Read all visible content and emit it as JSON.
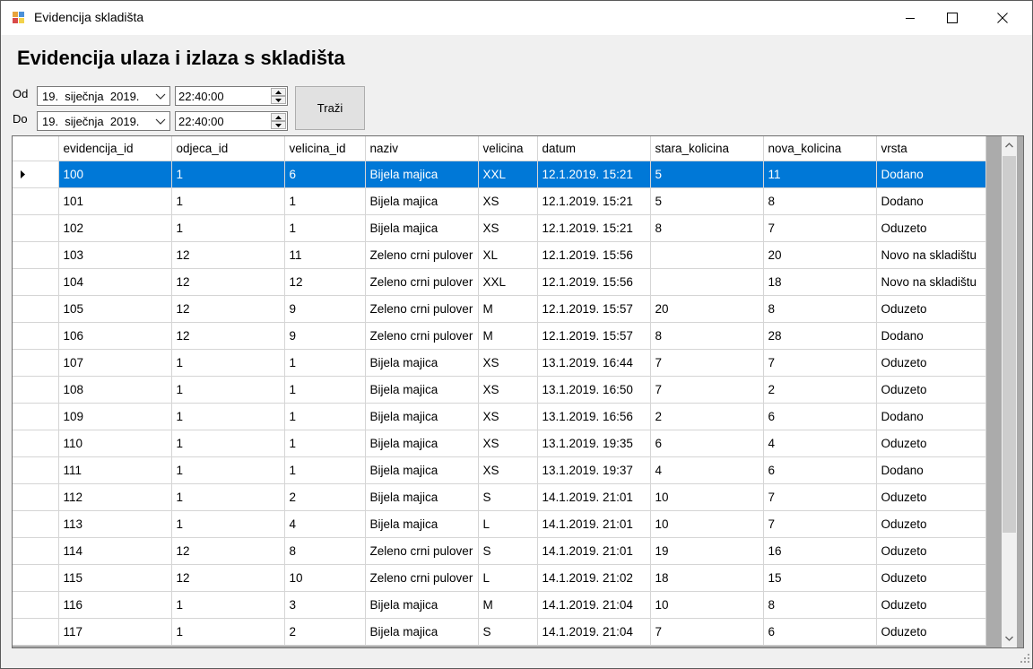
{
  "window": {
    "title": "Evidencija skladišta"
  },
  "heading": "Evidencija ulaza i izlaza s skladišta",
  "filters": {
    "from_label": "Od",
    "to_label": "Do",
    "from_date": "19.  siječnja  2019.",
    "to_date": "19.  siječnja  2019.",
    "from_time": "22:40:00",
    "to_time": "22:40:00"
  },
  "search_button": "Traži",
  "table": {
    "columns": [
      "evidencija_id",
      "odjeca_id",
      "velicina_id",
      "naziv",
      "velicina",
      "datum",
      "stara_kolicina",
      "nova_kolicina",
      "vrsta"
    ],
    "selected_row": 0,
    "rows": [
      [
        "100",
        "1",
        "6",
        "Bijela majica",
        "XXL",
        "12.1.2019. 15:21",
        "5",
        "11",
        "Dodano"
      ],
      [
        "101",
        "1",
        "1",
        "Bijela majica",
        "XS",
        "12.1.2019. 15:21",
        "5",
        "8",
        "Dodano"
      ],
      [
        "102",
        "1",
        "1",
        "Bijela majica",
        "XS",
        "12.1.2019. 15:21",
        "8",
        "7",
        "Oduzeto"
      ],
      [
        "103",
        "12",
        "11",
        "Zeleno crni pulover",
        "XL",
        "12.1.2019. 15:56",
        "",
        "20",
        "Novo na skladištu"
      ],
      [
        "104",
        "12",
        "12",
        "Zeleno crni pulover",
        "XXL",
        "12.1.2019. 15:56",
        "",
        "18",
        "Novo na skladištu"
      ],
      [
        "105",
        "12",
        "9",
        "Zeleno crni pulover",
        "M",
        "12.1.2019. 15:57",
        "20",
        "8",
        "Oduzeto"
      ],
      [
        "106",
        "12",
        "9",
        "Zeleno crni pulover",
        "M",
        "12.1.2019. 15:57",
        "8",
        "28",
        "Dodano"
      ],
      [
        "107",
        "1",
        "1",
        "Bijela majica",
        "XS",
        "13.1.2019. 16:44",
        "7",
        "7",
        "Oduzeto"
      ],
      [
        "108",
        "1",
        "1",
        "Bijela majica",
        "XS",
        "13.1.2019. 16:50",
        "7",
        "2",
        "Oduzeto"
      ],
      [
        "109",
        "1",
        "1",
        "Bijela majica",
        "XS",
        "13.1.2019. 16:56",
        "2",
        "6",
        "Dodano"
      ],
      [
        "110",
        "1",
        "1",
        "Bijela majica",
        "XS",
        "13.1.2019. 19:35",
        "6",
        "4",
        "Oduzeto"
      ],
      [
        "111",
        "1",
        "1",
        "Bijela majica",
        "XS",
        "13.1.2019. 19:37",
        "4",
        "6",
        "Dodano"
      ],
      [
        "112",
        "1",
        "2",
        "Bijela majica",
        "S",
        "14.1.2019. 21:01",
        "10",
        "7",
        "Oduzeto"
      ],
      [
        "113",
        "1",
        "4",
        "Bijela majica",
        "L",
        "14.1.2019. 21:01",
        "10",
        "7",
        "Oduzeto"
      ],
      [
        "114",
        "12",
        "8",
        "Zeleno crni pulover",
        "S",
        "14.1.2019. 21:01",
        "19",
        "16",
        "Oduzeto"
      ],
      [
        "115",
        "12",
        "10",
        "Zeleno crni pulover",
        "L",
        "14.1.2019. 21:02",
        "18",
        "15",
        "Oduzeto"
      ],
      [
        "116",
        "1",
        "3",
        "Bijela majica",
        "M",
        "14.1.2019. 21:04",
        "10",
        "8",
        "Oduzeto"
      ],
      [
        "117",
        "1",
        "2",
        "Bijela majica",
        "S",
        "14.1.2019. 21:04",
        "7",
        "6",
        "Oduzeto"
      ]
    ]
  },
  "colors": {
    "selection": "#0078d7",
    "grid_background": "#ababab"
  },
  "icons": [
    "app-icon",
    "minimize-icon",
    "maximize-icon",
    "close-icon",
    "chevron-down-icon",
    "spin-up-icon",
    "spin-down-icon",
    "row-pointer-icon",
    "scroll-up-icon",
    "scroll-down-icon",
    "size-grip-icon"
  ]
}
